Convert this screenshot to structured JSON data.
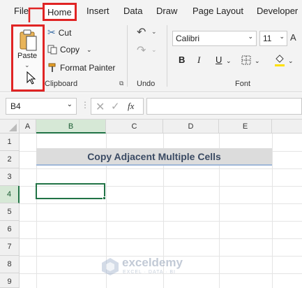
{
  "menu": {
    "tabs": [
      "File",
      "Home",
      "Insert",
      "Data",
      "Draw",
      "Page Layout",
      "Developer"
    ],
    "active_tab": "Home"
  },
  "ribbon": {
    "clipboard": {
      "paste_label": "Paste",
      "cut_label": "Cut",
      "copy_label": "Copy",
      "format_painter_label": "Format Painter",
      "group_label": "Clipboard"
    },
    "undo": {
      "group_label": "Undo"
    },
    "font": {
      "font_name": "Calibri",
      "font_size": "11",
      "group_label": "Font",
      "bold": "B",
      "italic": "I",
      "underline": "U"
    }
  },
  "formula_bar": {
    "name_box": "B4",
    "fx_label": "fx",
    "formula": ""
  },
  "grid": {
    "columns": [
      "A",
      "B",
      "C",
      "D",
      "E"
    ],
    "rows": [
      "1",
      "2",
      "3",
      "4",
      "5",
      "6",
      "7",
      "8",
      "9"
    ],
    "selected_column": "B",
    "selected_row": "4",
    "title_cell": "Copy Adjacent Multiple Cells"
  },
  "watermark": {
    "name": "exceldemy",
    "tagline": "EXCEL · DATA · BI"
  },
  "colors": {
    "accent_red": "#e02424",
    "excel_green": "#217346",
    "title_text": "#3a4a63"
  }
}
